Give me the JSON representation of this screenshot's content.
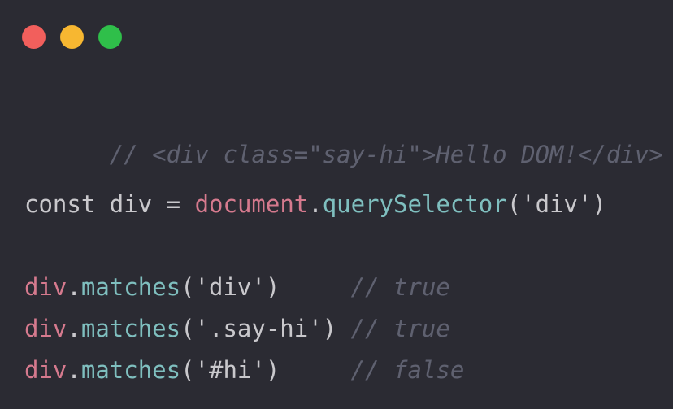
{
  "window": {
    "buttons": [
      {
        "name": "close",
        "color": "#f25f5c"
      },
      {
        "name": "minimize",
        "color": "#f7b731"
      },
      {
        "name": "maximize",
        "color": "#2fbf4a"
      }
    ]
  },
  "code": {
    "line1": {
      "comment": "// <div class=\"say-hi\">Hello DOM!</div>"
    },
    "line2": {
      "kw": "const",
      "sp1": " ",
      "name": "div",
      "eq": " = ",
      "obj": "document",
      "dot": ".",
      "method": "querySelector",
      "open": "(",
      "arg": "'div'",
      "close": ")"
    },
    "line3": {
      "obj": "div",
      "dot": ".",
      "method": "matches",
      "open": "(",
      "arg": "'div'",
      "close": ")",
      "pad": "     ",
      "comment": "// true"
    },
    "line4": {
      "obj": "div",
      "dot": ".",
      "method": "matches",
      "open": "(",
      "arg": "'.say-hi'",
      "close": ")",
      "pad": " ",
      "comment": "// true"
    },
    "line5": {
      "obj": "div",
      "dot": ".",
      "method": "matches",
      "open": "(",
      "arg": "'#hi'",
      "close": ")",
      "pad": "     ",
      "comment": "// false"
    }
  }
}
